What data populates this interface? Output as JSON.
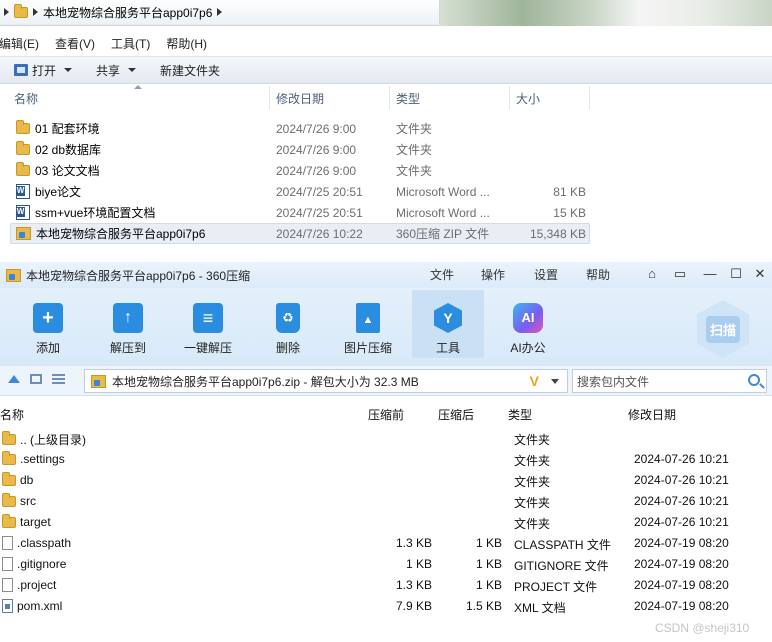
{
  "explorer": {
    "address": {
      "path": "本地宠物综合服务平台app0i7p6"
    },
    "menu": [
      "编辑(E)",
      "查看(V)",
      "工具(T)",
      "帮助(H)"
    ],
    "commands": {
      "open": "打开",
      "share": "共享",
      "new_folder": "新建文件夹"
    },
    "columns": {
      "name": "名称",
      "date": "修改日期",
      "type": "类型",
      "size": "大小"
    },
    "files": [
      {
        "name": "01 配套环境",
        "date": "2024/7/26 9:00",
        "type": "文件夹",
        "size": "",
        "icon": "folder-icon"
      },
      {
        "name": "02 db数据库",
        "date": "2024/7/26 9:00",
        "type": "文件夹",
        "size": "",
        "icon": "folder-icon"
      },
      {
        "name": "03 论文文档",
        "date": "2024/7/26 9:00",
        "type": "文件夹",
        "size": "",
        "icon": "folder-icon"
      },
      {
        "name": "biye论文",
        "date": "2024/7/25 20:51",
        "type": "Microsoft Word ...",
        "size": "81 KB",
        "icon": "word-doc-icon"
      },
      {
        "name": "ssm+vue环境配置文档",
        "date": "2024/7/25 20:51",
        "type": "Microsoft Word ...",
        "size": "15 KB",
        "icon": "word-doc-icon"
      },
      {
        "name": "本地宠物综合服务平台app0i7p6",
        "date": "2024/7/26 10:22",
        "type": "360压缩 ZIP 文件",
        "size": "15,348 KB",
        "icon": "zip-archive-icon"
      }
    ]
  },
  "zip": {
    "title": "本地宠物综合服务平台app0i7p6 - 360压缩",
    "menu": {
      "file": "文件",
      "operate": "操作",
      "settings": "设置",
      "help": "帮助"
    },
    "tools": {
      "add": "添加",
      "extract_to": "解压到",
      "one_click": "一键解压",
      "delete": "删除",
      "image_compress": "图片压缩",
      "tools": "工具",
      "ai_office": "AI办公"
    },
    "scan_label": "扫描",
    "path_text": "本地宠物综合服务平台app0i7p6.zip - 解包大小为 32.3 MB",
    "search_placeholder": "搜索包内文件",
    "columns": {
      "name": "名称",
      "before": "压缩前",
      "after": "压缩后",
      "type": "类型",
      "date": "修改日期"
    },
    "entries": [
      {
        "name": ".. (上级目录)",
        "before": "",
        "after": "",
        "type": "文件夹",
        "date": "",
        "icon": "folder-icon"
      },
      {
        "name": ".settings",
        "before": "",
        "after": "",
        "type": "文件夹",
        "date": "2024-07-26 10:21",
        "icon": "folder-icon"
      },
      {
        "name": "db",
        "before": "",
        "after": "",
        "type": "文件夹",
        "date": "2024-07-26 10:21",
        "icon": "folder-icon"
      },
      {
        "name": "src",
        "before": "",
        "after": "",
        "type": "文件夹",
        "date": "2024-07-26 10:21",
        "icon": "folder-icon"
      },
      {
        "name": "target",
        "before": "",
        "after": "",
        "type": "文件夹",
        "date": "2024-07-26 10:21",
        "icon": "folder-icon"
      },
      {
        "name": ".classpath",
        "before": "1.3 KB",
        "after": "1 KB",
        "type": "CLASSPATH 文件",
        "date": "2024-07-19 08:20",
        "icon": "file-icon"
      },
      {
        "name": ".gitignore",
        "before": "1 KB",
        "after": "1 KB",
        "type": "GITIGNORE 文件",
        "date": "2024-07-19 08:20",
        "icon": "file-icon"
      },
      {
        "name": ".project",
        "before": "1.3 KB",
        "after": "1 KB",
        "type": "PROJECT 文件",
        "date": "2024-07-19 08:20",
        "icon": "file-icon"
      },
      {
        "name": "pom.xml",
        "before": "7.9 KB",
        "after": "1.5 KB",
        "type": "XML 文档",
        "date": "2024-07-19 08:20",
        "icon": "xml-file-icon"
      }
    ]
  },
  "watermark": "CSDN @sheji310"
}
